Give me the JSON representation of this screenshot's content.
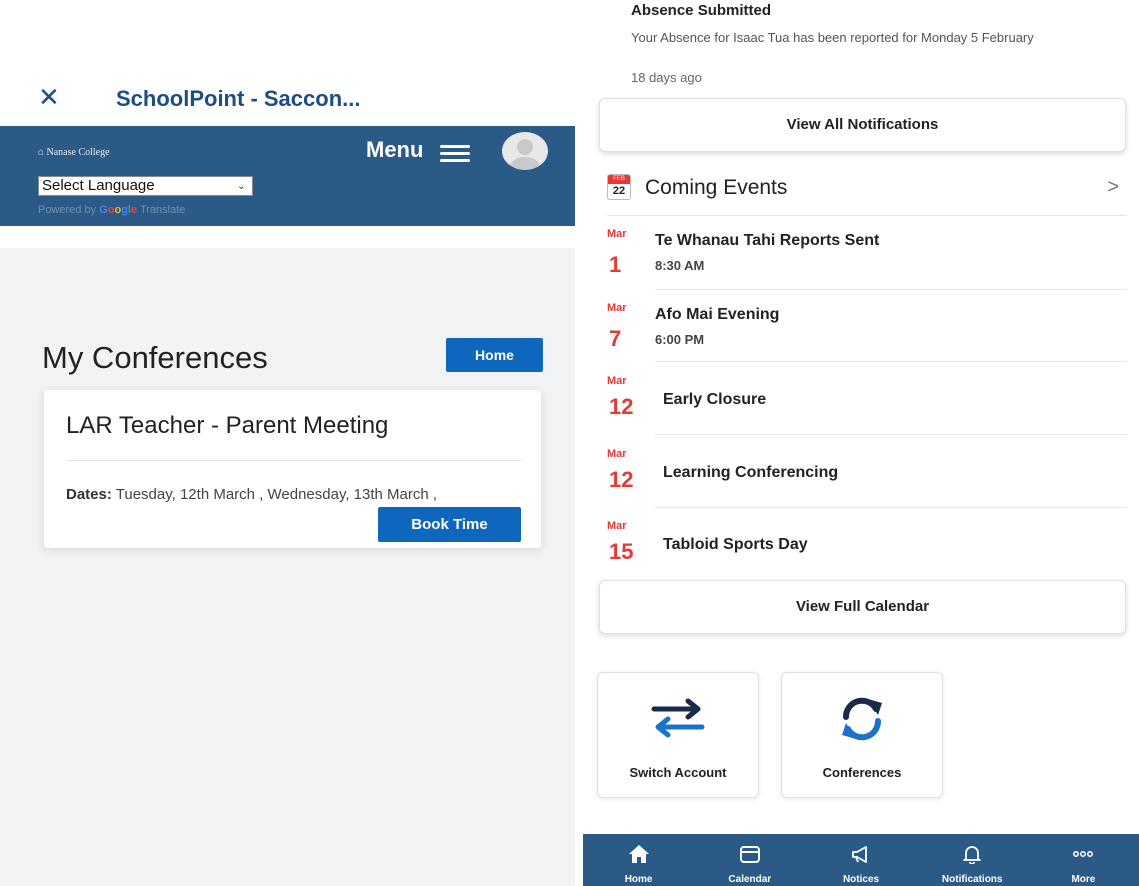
{
  "left": {
    "window_title": "SchoolPoint - Saccon...",
    "college_name": "Nanase College",
    "menu_label": "Menu",
    "language_select": "Select Language",
    "powered_by": "Powered by",
    "google_letters": [
      "G",
      "o",
      "o",
      "g",
      "l",
      "e"
    ],
    "translate_label": "Translate",
    "page_title": "My Conferences",
    "home_label": "Home",
    "card": {
      "title": "LAR Teacher - Parent Meeting",
      "dates_label": "Dates:",
      "dates_value": "Tuesday, 12th March , Wednesday, 13th March ,",
      "book_label": "Book Time"
    }
  },
  "right": {
    "notification": {
      "title": "Absence Submitted",
      "text": "Your Absence for Isaac Tua has been reported for Monday 5 February",
      "time": "18 days ago"
    },
    "view_all_label": "View All Notifications",
    "events_header": {
      "icon_month": "FEB",
      "icon_day": "22",
      "title": "Coming Events"
    },
    "events": [
      {
        "month": "Mar",
        "day": "1",
        "title": "Te Whanau Tahi Reports Sent",
        "time": "8:30 AM"
      },
      {
        "month": "Mar",
        "day": "7",
        "title": "Afo Mai Evening",
        "time": "6:00 PM"
      },
      {
        "month": "Mar",
        "day": "12",
        "title": "Early Closure",
        "time": ""
      },
      {
        "month": "Mar",
        "day": "12",
        "title": "Learning Conferencing",
        "time": ""
      },
      {
        "month": "Mar",
        "day": "15",
        "title": "Tabloid Sports Day",
        "time": ""
      }
    ],
    "view_calendar_label": "View Full Calendar",
    "tiles": [
      {
        "label": "Switch Account",
        "icon": "switch-arrows-icon"
      },
      {
        "label": "Conferences",
        "icon": "refresh-icon"
      }
    ],
    "nav": [
      {
        "label": "Home",
        "icon": "home-icon"
      },
      {
        "label": "Calendar",
        "icon": "calendar-icon"
      },
      {
        "label": "Notices",
        "icon": "megaphone-icon"
      },
      {
        "label": "Notifications",
        "icon": "bell-icon"
      },
      {
        "label": "More",
        "icon": "more-icon"
      }
    ]
  },
  "colors": {
    "brand_blue": "#2c5a87",
    "button_blue": "#0e66bd",
    "event_red": "#e53935",
    "icon_blue": "#1a73c8"
  }
}
